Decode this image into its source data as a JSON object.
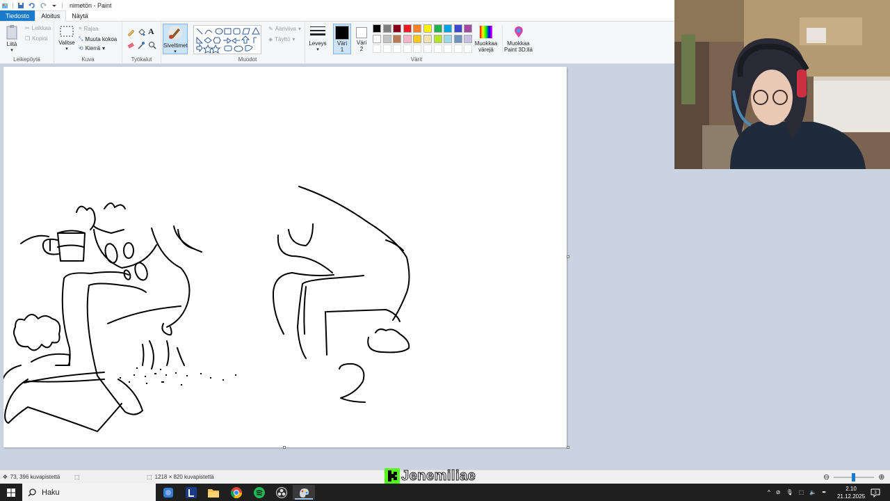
{
  "window": {
    "title": "nimetön - Paint"
  },
  "tabs": [
    {
      "label": "Tiedosto"
    },
    {
      "label": "Aloitus"
    },
    {
      "label": "Näytä"
    }
  ],
  "ribbon": {
    "clipboard": {
      "paste": "Liitä",
      "cut": "Leikkaa",
      "copy": "Kopioi",
      "group": "Leikepöytä"
    },
    "image": {
      "select": "Valitse",
      "crop": "Rajaa",
      "resize": "Muuta kokoa",
      "rotate": "Kierrä",
      "group": "Kuva"
    },
    "tools": {
      "group": "Työkalut"
    },
    "brushes": {
      "label": "Siveltimet"
    },
    "shapes": {
      "outline": "Ääriviiva",
      "fill": "Täyttö",
      "group": "Muodot"
    },
    "size": {
      "label": "Leveys"
    },
    "color1": {
      "label": "Väri 1",
      "line1": "Väri",
      "line2": "1"
    },
    "color2": {
      "label": "Väri 2",
      "line1": "Väri",
      "line2": "2"
    },
    "colors": {
      "group": "Värit",
      "row1": [
        "#000000",
        "#7f7f7f",
        "#880015",
        "#ed1c24",
        "#ff7f27",
        "#fff200",
        "#22b14c",
        "#00a2e8",
        "#3f48cc",
        "#a349a4"
      ],
      "row2": [
        "#ffffff",
        "#c3c3c3",
        "#b97a57",
        "#ffaec9",
        "#ffc90e",
        "#efe4b0",
        "#b5e61d",
        "#99d9ea",
        "#7092be",
        "#c8bfe7"
      ],
      "edit": {
        "line1": "Muokkaa",
        "line2": "värejä"
      },
      "paint3d": {
        "line1": "Muokkaa",
        "line2": "Paint 3D:llä"
      }
    }
  },
  "status": {
    "cursor": "73, 396 kuvapistettä",
    "canvas_size": "1218 × 820 kuvapistettä"
  },
  "watermark": {
    "text": "Jenemiliae"
  },
  "taskbar": {
    "search_placeholder": "Haku",
    "time": "2.10",
    "date": "21.12.2025"
  },
  "accent": "#1979ca"
}
